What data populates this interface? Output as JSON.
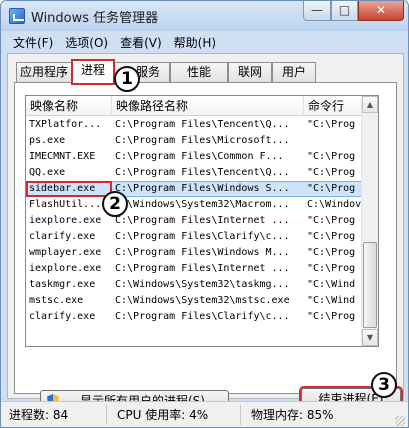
{
  "window": {
    "title": "Windows 任务管理器",
    "minimize": "—",
    "maximize": "□",
    "close": "✕"
  },
  "menu": [
    "文件(F)",
    "选项(O)",
    "查看(V)",
    "帮助(H)"
  ],
  "tabs": [
    {
      "label": "应用程序",
      "active": false
    },
    {
      "label": "进程",
      "active": true
    },
    {
      "label": "服务",
      "active": false
    },
    {
      "label": "性能",
      "active": false
    },
    {
      "label": "联网",
      "active": false
    },
    {
      "label": "用户",
      "active": false
    }
  ],
  "table": {
    "columns": [
      "映像名称",
      "映像路径名称",
      "命令行"
    ],
    "rows": [
      [
        "TXPlatfor...",
        "C:\\Program Files\\Tencent\\Q...",
        "\"C:\\Prog"
      ],
      [
        "ps.exe",
        "C:\\Program Files\\Microsoft...",
        ""
      ],
      [
        "IMECMNT.EXE",
        "C:\\Program Files\\Common F...",
        "\"C:\\Prog"
      ],
      [
        "QQ.exe",
        "C:\\Program Files\\Tencent\\Q...",
        "\"C:\\Prog"
      ],
      [
        "sidebar.exe",
        "C:\\Program Files\\Windows S...",
        "\"C:\\Prog"
      ],
      [
        "FlashUtil...",
        "C:\\Windows\\System32\\Macrom...",
        "C:\\Windov"
      ],
      [
        "iexplore.exe",
        "C:\\Program Files\\Internet ...",
        "\"C:\\Prog"
      ],
      [
        "clarify.exe",
        "C:\\Program Files\\Clarify\\c...",
        "\"C:\\Prog"
      ],
      [
        "wmplayer.exe",
        "C:\\Program Files\\Windows M...",
        "\"C:\\Prog"
      ],
      [
        "iexplore.exe",
        "C:\\Program Files\\Internet ...",
        "\"C:\\Prog"
      ],
      [
        "taskmgr.exe",
        "C:\\Windows\\System32\\taskmg...",
        "\"C:\\Wind"
      ],
      [
        "mstsc.exe",
        "C:\\Windows\\System32\\mstsc.exe",
        "\"C:\\Wind"
      ],
      [
        "clarify.exe",
        "C:\\Program Files\\Clarify\\c...",
        "\"C:\\Prog"
      ]
    ],
    "selected_index": 4
  },
  "buttons": {
    "show_all": "显示所有用户的进程(S)",
    "end_process": "结束进程(E)"
  },
  "markers": [
    "1",
    "2",
    "3"
  ],
  "status": {
    "processes": "进程数: 84",
    "cpu": "CPU 使用率: 4%",
    "memory": "物理内存: 85%"
  },
  "colors": {
    "highlight": "#d22b2b",
    "selection": "#cde4fb"
  }
}
